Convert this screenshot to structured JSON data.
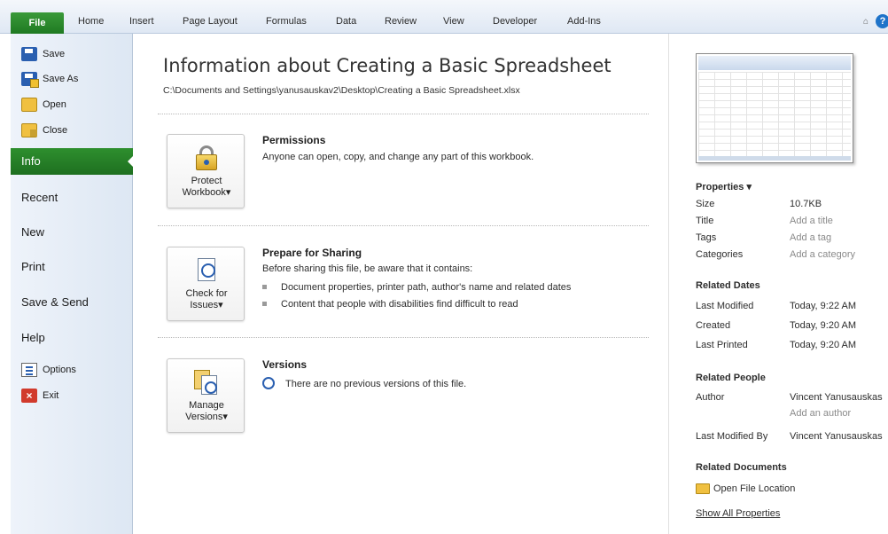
{
  "ribbon": {
    "tabs": [
      "File",
      "Home",
      "Insert",
      "Page Layout",
      "Formulas",
      "Data",
      "Review",
      "View",
      "Developer",
      "Add-Ins"
    ],
    "help_glyph": "?"
  },
  "sidebar": {
    "commands": [
      {
        "label": "Save",
        "icon": "save-icon"
      },
      {
        "label": "Save As",
        "icon": "save-as-icon"
      },
      {
        "label": "Open",
        "icon": "open-folder-icon"
      },
      {
        "label": "Close",
        "icon": "close-folder-icon"
      }
    ],
    "items": [
      "Info",
      "Recent",
      "New",
      "Print",
      "Save & Send",
      "Help"
    ],
    "active": "Info",
    "bottom_commands": [
      {
        "label": "Options",
        "icon": "options-icon"
      },
      {
        "label": "Exit",
        "icon": "exit-icon"
      }
    ]
  },
  "main": {
    "title": "Information about Creating a Basic Spreadsheet",
    "path": "C:\\Documents and Settings\\yanusauskav2\\Desktop\\Creating a Basic Spreadsheet.xlsx",
    "permissions": {
      "button_line1": "Protect",
      "button_line2": "Workbook",
      "title": "Permissions",
      "text": "Anyone can open, copy, and change any part of this workbook."
    },
    "sharing": {
      "button_line1": "Check for",
      "button_line2": "Issues",
      "title": "Prepare for Sharing",
      "text": "Before sharing this file, be aware that it contains:",
      "bullets": [
        "Document properties, printer path, author's name and related dates",
        "Content that people with disabilities find difficult to read"
      ]
    },
    "versions": {
      "button_line1": "Manage",
      "button_line2": "Versions",
      "title": "Versions",
      "text": "There are no previous versions of this file."
    },
    "dropdown_glyph": "▾"
  },
  "right": {
    "properties_header": "Properties",
    "properties": [
      {
        "label": "Size",
        "value": "10.7KB"
      },
      {
        "label": "Title",
        "value": "Add a title"
      },
      {
        "label": "Tags",
        "value": "Add a tag"
      },
      {
        "label": "Categories",
        "value": "Add a category"
      }
    ],
    "related_dates_header": "Related Dates",
    "dates": [
      {
        "label": "Last Modified",
        "value": "Today, 9:22 AM"
      },
      {
        "label": "Created",
        "value": "Today, 9:20 AM"
      },
      {
        "label": "Last Printed",
        "value": "Today, 9:20 AM"
      }
    ],
    "related_people_header": "Related People",
    "author_label": "Author",
    "author_value": "Vincent Yanusauskas",
    "add_author": "Add an author",
    "last_modified_by_label": "Last Modified By",
    "last_modified_by_value": "Vincent Yanusauskas",
    "related_documents_header": "Related Documents",
    "open_file_location": "Open File Location",
    "show_all": "Show All Properties"
  }
}
